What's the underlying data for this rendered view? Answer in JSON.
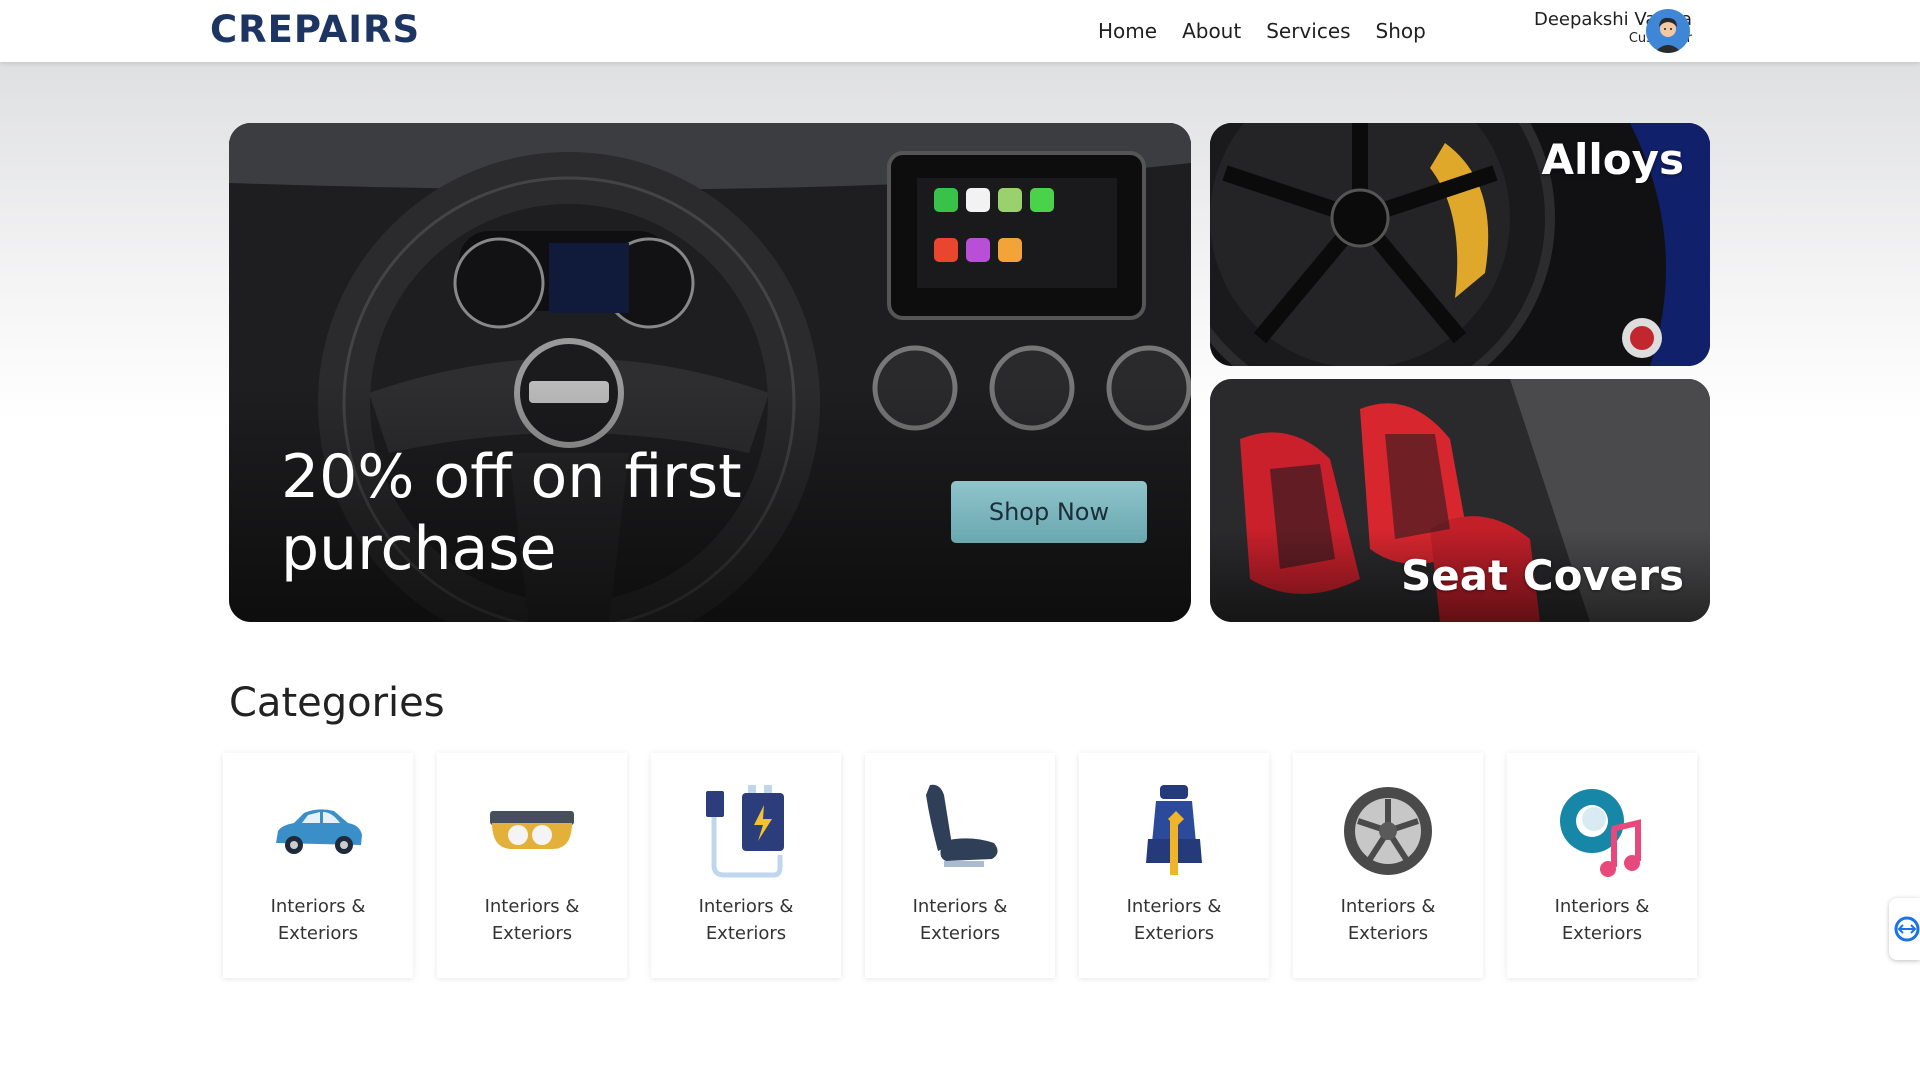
{
  "brand": {
    "logo_text": "CREPAIRS",
    "color": "#1c3563"
  },
  "nav": {
    "items": [
      "Home",
      "About",
      "Services",
      "Shop"
    ]
  },
  "user": {
    "name": "Deepakshi Varma",
    "role": "Customer"
  },
  "hero": {
    "title": "20% off on first purchase",
    "cta_label": "Shop Now",
    "cta_color": "#7db6bd"
  },
  "side_cards": [
    {
      "title": "Alloys"
    },
    {
      "title": "Seat Covers"
    }
  ],
  "categories": {
    "heading": "Categories",
    "items": [
      {
        "icon": "car-icon",
        "label_line1": "Interiors &",
        "label_line2": "Exteriors"
      },
      {
        "icon": "headlight-icon",
        "label_line1": "Interiors &",
        "label_line2": "Exteriors"
      },
      {
        "icon": "battery-charger-icon",
        "label_line1": "Interiors &",
        "label_line2": "Exteriors"
      },
      {
        "icon": "car-seat-icon",
        "label_line1": "Interiors &",
        "label_line2": "Exteriors"
      },
      {
        "icon": "seat-cover-icon",
        "label_line1": "Interiors &",
        "label_line2": "Exteriors"
      },
      {
        "icon": "alloy-wheel-icon",
        "label_line1": "Interiors &",
        "label_line2": "Exteriors"
      },
      {
        "icon": "music-speaker-icon",
        "label_line1": "Interiors &",
        "label_line2": "Exteriors"
      }
    ]
  }
}
